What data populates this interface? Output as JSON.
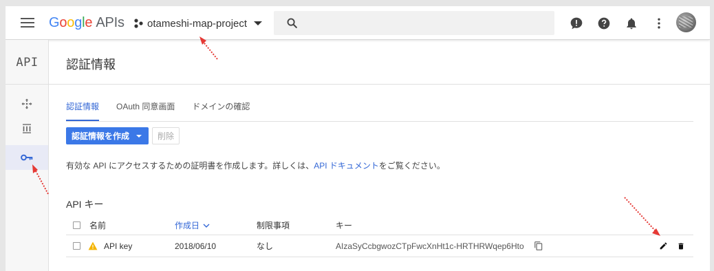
{
  "topbar": {
    "logo_google": [
      "G",
      "o",
      "o",
      "g",
      "l",
      "e"
    ],
    "logo_apis": "APIs",
    "project_name": "otameshi-map-project",
    "search_placeholder": ""
  },
  "rail": {
    "api_label": "API"
  },
  "main": {
    "page_title": "認証情報",
    "tabs": [
      {
        "label": "認証情報",
        "active": true
      },
      {
        "label": "OAuth 同意画面",
        "active": false
      },
      {
        "label": "ドメインの確認",
        "active": false
      }
    ],
    "create_button": "認証情報を作成",
    "delete_button": "削除",
    "description_pre": "有効な API にアクセスするための証明書を作成します。詳しくは、",
    "description_link": "API ドキュメント",
    "description_post": "をご覧ください。",
    "section_title": "API キー",
    "table": {
      "headers": {
        "name": "名前",
        "created": "作成日",
        "restrictions": "制限事項",
        "key": "キー"
      },
      "rows": [
        {
          "name": "API key",
          "created": "2018/06/10",
          "restrictions": "なし",
          "key": "AIzaSyCcbgwozCTpFwcXnHt1c-HRTHRWqep6Hto"
        }
      ]
    }
  },
  "colors": {
    "accent": "#3367d6",
    "button": "#3b78e7",
    "warning": "#f4b400",
    "annotation": "#e53935"
  }
}
